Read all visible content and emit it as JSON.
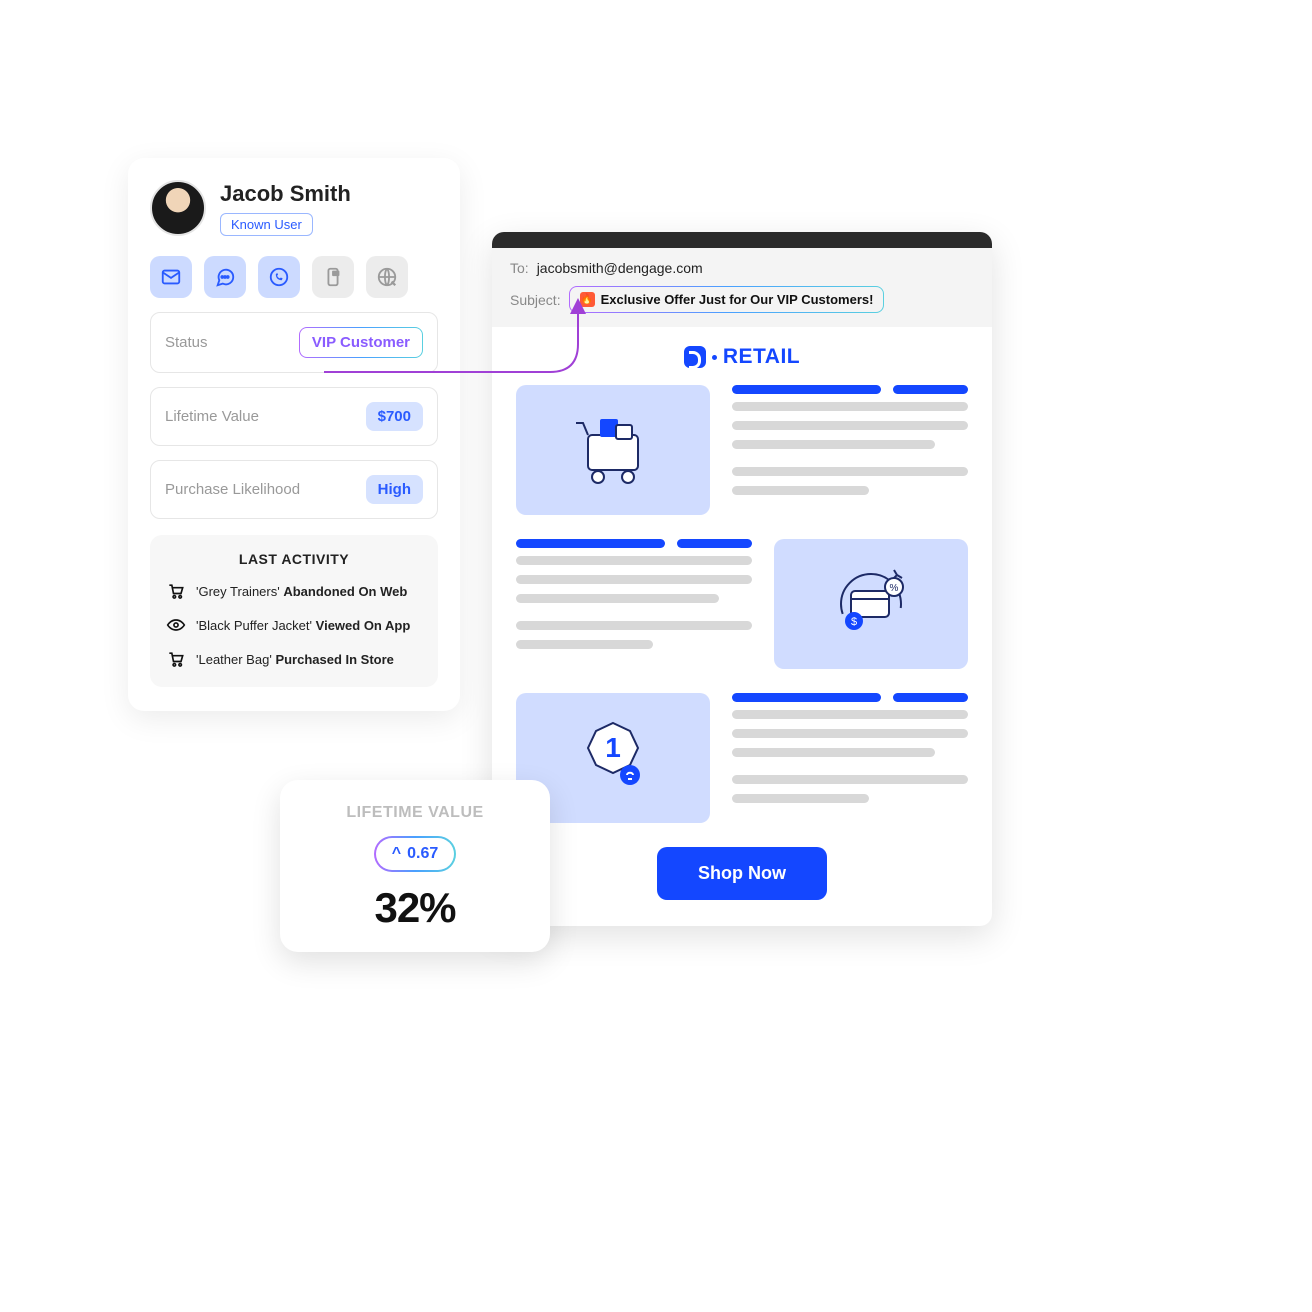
{
  "profile": {
    "name": "Jacob Smith",
    "known_user": "Known User",
    "stats": {
      "status_label": "Status",
      "status_value": "VIP Customer",
      "ltv_label": "Lifetime Value",
      "ltv_value": "$700",
      "likelihood_label": "Purchase Likelihood",
      "likelihood_value": "High"
    },
    "last_activity": {
      "title": "LAST ACTIVITY",
      "items": [
        {
          "product": "Grey Trainers",
          "action": "Abandoned On Web"
        },
        {
          "product": "Black Puffer Jacket",
          "action": "Viewed On App"
        },
        {
          "product": "Leather Bag",
          "action": "Purchased In Store"
        }
      ]
    }
  },
  "ltv_card": {
    "title": "LIFETIME VALUE",
    "delta": "0.67",
    "percent": "32%"
  },
  "email": {
    "to_label": "To:",
    "to_value": "jacobsmith@dengage.com",
    "subject_label": "Subject:",
    "subject_value": "Exclusive Offer Just for Our VIP Customers!",
    "brand": "RETAIL",
    "cta": "Shop Now"
  }
}
